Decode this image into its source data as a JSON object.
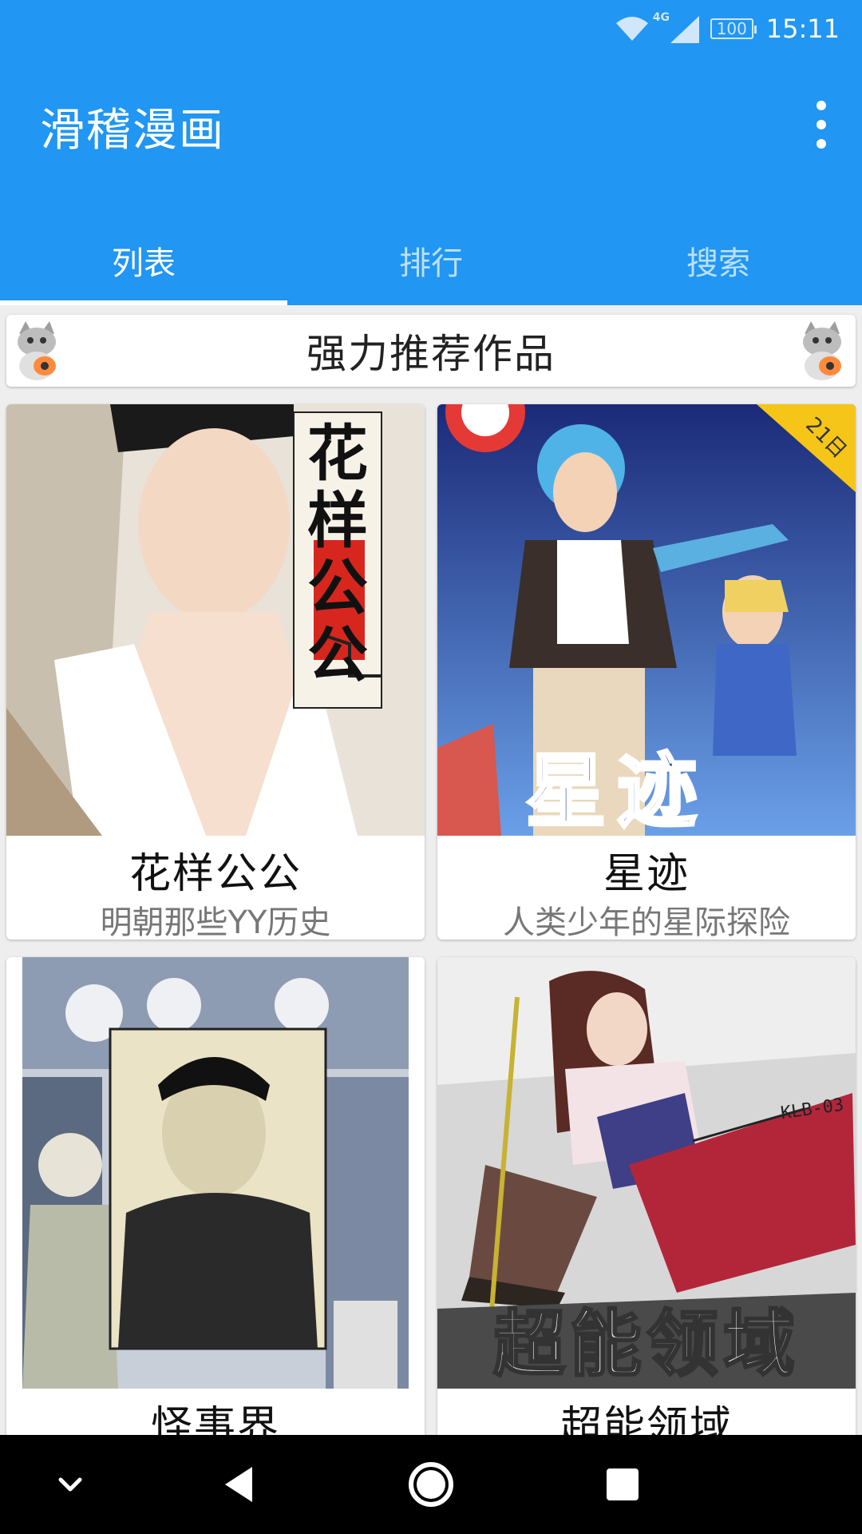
{
  "status_bar": {
    "network": "4G",
    "battery": "100",
    "time": "15:11"
  },
  "toolbar": {
    "title": "滑稽漫画",
    "overflow_icon": "more-vert-icon"
  },
  "tabs": [
    {
      "label": "列表",
      "active": true
    },
    {
      "label": "排行",
      "active": false
    },
    {
      "label": "搜索",
      "active": false
    }
  ],
  "banner": {
    "title": "强力推荐作品",
    "icon": "cat-mascot-icon"
  },
  "comics": [
    {
      "title": "花样公公",
      "subtitle": "明朝那些YY历史",
      "cover_text": "花样公公"
    },
    {
      "title": "星迹",
      "subtitle": "人类少年的星际探险",
      "cover_text": "星迹",
      "cover_badge": "21日"
    },
    {
      "title": "怪事界",
      "subtitle": ""
    },
    {
      "title": "超能领域",
      "subtitle": "",
      "cover_text": "超能领域",
      "cover_tag": "KLB-03"
    }
  ],
  "colors": {
    "primary": "#2196f3",
    "background": "#eeeeee",
    "card": "#ffffff"
  },
  "navigation_bar": {
    "icons": [
      "chevron-down-icon",
      "back-triangle-icon",
      "home-circle-icon",
      "recents-square-icon"
    ]
  }
}
